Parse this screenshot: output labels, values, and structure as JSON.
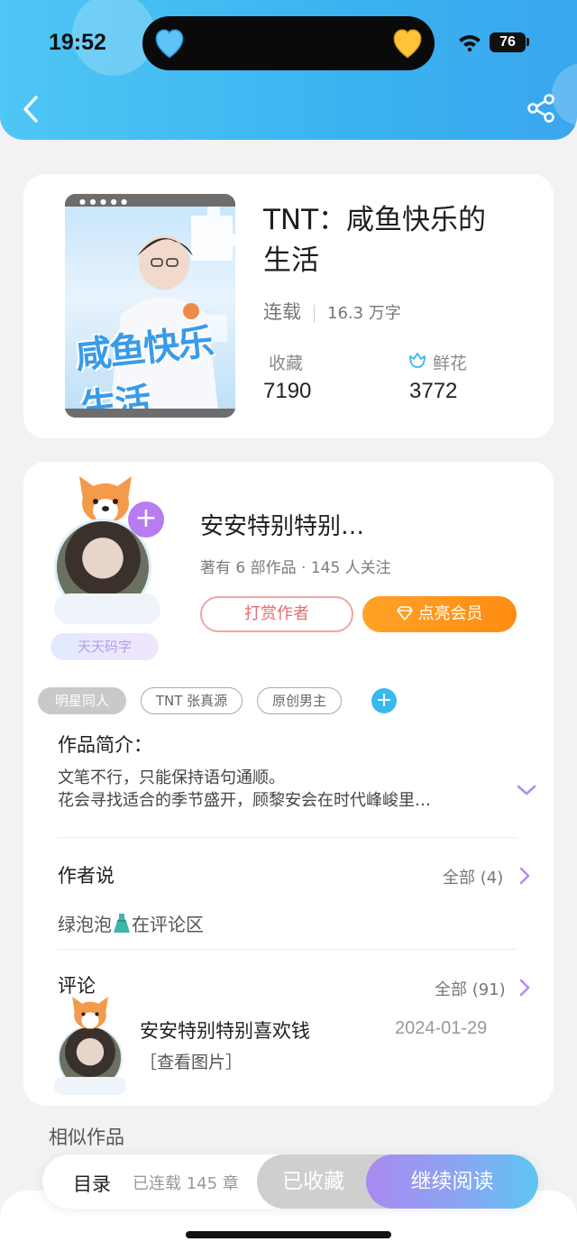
{
  "status_bar": {
    "time": "19:52",
    "battery": "76"
  },
  "icons": {
    "back": "chevron-left-icon",
    "share": "share-icon",
    "flower": "tulip-icon",
    "diamond": "diamond-icon",
    "expand": "chevron-down-icon",
    "more": "chevron-right-icon",
    "dress": "dress-emoji"
  },
  "colors": {
    "header": "#3ab3f0",
    "vip_button": "#ff9a20",
    "tip_border": "#f0a5a5",
    "tag_add": "#39b8f0",
    "follow_plus": "#b77cf0",
    "continue_start": "#a98af0",
    "continue_end": "#5dc6f2"
  },
  "book": {
    "cover_title_art": "咸鱼快乐生活",
    "title_line1": "TNT：咸鱼快乐的",
    "title_line2": "生活",
    "status": "连载",
    "word_count": "16.3 万字",
    "favorites_label": "收藏",
    "favorites_count": "7190",
    "flowers_label": "鲜花",
    "flowers_count": "3772"
  },
  "author": {
    "name": "安安特别特别…",
    "meta": "著有 6 部作品 · 145 人关注",
    "badge": "天天码字",
    "tip_button": "打赏作者",
    "vip_button": "点亮会员",
    "follow": "+"
  },
  "tags": [
    "明星同人",
    "TNT 张真源",
    "原创男主"
  ],
  "tag_add": "+",
  "intro": {
    "title": "作品简介：",
    "line1": "文笔不行，只能保持语句通顺。",
    "line2": "花会寻找适合的季节盛开，顾黎安会在时代峰峻里…"
  },
  "author_says": {
    "title": "作者说",
    "all_label": "全部 (4)",
    "note_before": "绿泡泡",
    "note_after": "在评论区"
  },
  "comments": {
    "title": "评论",
    "all_label": "全部 (91)",
    "items": [
      {
        "user": "安安特别特别喜欢钱",
        "date": "2024-01-29",
        "text": "［查看图片］"
      }
    ]
  },
  "similar_title": "相似作品",
  "bottom_bar": {
    "toc": "目录",
    "chapters": "已连载 145 章",
    "collected": "已收藏",
    "continue": "继续阅读"
  }
}
